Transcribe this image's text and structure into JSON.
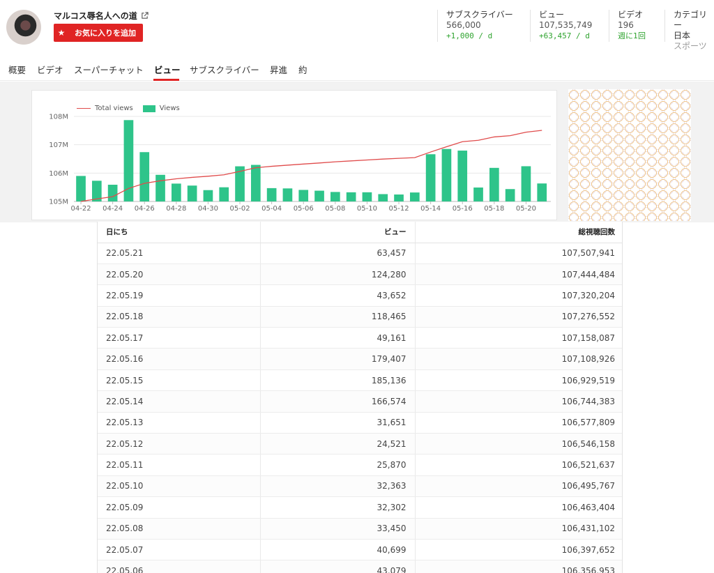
{
  "channel": {
    "title": "マルコス辱名人への道",
    "favorite_label": "お気に入りを追加"
  },
  "stats": [
    {
      "label": "サブスクライバー",
      "value": "566,000",
      "delta": "+1,000 / d"
    },
    {
      "label": "ビュー",
      "value": "107,535,749",
      "delta": "+63,457 / d"
    },
    {
      "label": "ビデオ",
      "value": "196",
      "delta": "週に1回"
    },
    {
      "label": "カテゴリー",
      "value": "日本",
      "sub": "スポーツ"
    }
  ],
  "tabs": [
    {
      "label": "概要"
    },
    {
      "label": "ビデオ"
    },
    {
      "label": "スーパーチャット"
    },
    {
      "label": "ビュー",
      "active": true
    },
    {
      "label": "サブスクライバー"
    },
    {
      "label": "昇進"
    },
    {
      "label": "約"
    }
  ],
  "chart_data": {
    "type": "bar",
    "legend": [
      "Total views",
      "Views"
    ],
    "colors": {
      "line": "#e04b4b",
      "bars": "#2ec48a"
    },
    "y_ticks": [
      "108M",
      "107M",
      "106M",
      "105M"
    ],
    "ylim": [
      105000000,
      108000000
    ],
    "x_ticks": [
      "04-22",
      "04-24",
      "04-26",
      "04-28",
      "04-30",
      "05-02",
      "05-04",
      "05-06",
      "05-08",
      "05-10",
      "05-12",
      "05-14",
      "05-16",
      "05-18",
      "05-20"
    ],
    "categories": [
      "04-22",
      "04-23",
      "04-24",
      "04-25",
      "04-26",
      "04-27",
      "04-28",
      "04-29",
      "04-30",
      "05-01",
      "05-02",
      "05-03",
      "05-04",
      "05-05",
      "05-06",
      "05-07",
      "05-08",
      "05-09",
      "05-10",
      "05-11",
      "05-12",
      "05-13",
      "05-14",
      "05-15",
      "05-16",
      "05-17",
      "05-18",
      "05-19",
      "05-20",
      "05-21"
    ],
    "series": [
      {
        "name": "Views",
        "kind": "bar",
        "values": [
          90000,
          73000,
          59000,
          287000,
          174000,
          94000,
          63000,
          56000,
          40000,
          50000,
          124000,
          129000,
          47000,
          46000,
          40699,
          38000,
          33450,
          32302,
          32363,
          25870,
          24521,
          31651,
          166574,
          185136,
          179407,
          49161,
          118465,
          43652,
          124280,
          63457
        ]
      },
      {
        "name": "Total views",
        "kind": "line",
        "values": [
          105000000,
          105090000,
          105170000,
          105460000,
          105640000,
          105730000,
          105800000,
          105850000,
          105890000,
          105940000,
          106060000,
          106190000,
          106240000,
          106280000,
          106320000,
          106356953,
          106397652,
          106431102,
          106463404,
          106495767,
          106521637,
          106546158,
          106744383,
          106929519,
          107108926,
          107158087,
          107276552,
          107320204,
          107444484,
          107507941
        ]
      }
    ]
  },
  "table": {
    "headers": [
      "日にち",
      "ビュー",
      "総視聴回数"
    ],
    "rows": [
      [
        "22.05.21",
        "63,457",
        "107,507,941"
      ],
      [
        "22.05.20",
        "124,280",
        "107,444,484"
      ],
      [
        "22.05.19",
        "43,652",
        "107,320,204"
      ],
      [
        "22.05.18",
        "118,465",
        "107,276,552"
      ],
      [
        "22.05.17",
        "49,161",
        "107,158,087"
      ],
      [
        "22.05.16",
        "179,407",
        "107,108,926"
      ],
      [
        "22.05.15",
        "185,136",
        "106,929,519"
      ],
      [
        "22.05.14",
        "166,574",
        "106,744,383"
      ],
      [
        "22.05.13",
        "31,651",
        "106,577,809"
      ],
      [
        "22.05.12",
        "24,521",
        "106,546,158"
      ],
      [
        "22.05.11",
        "25,870",
        "106,521,637"
      ],
      [
        "22.05.10",
        "32,363",
        "106,495,767"
      ],
      [
        "22.05.09",
        "32,302",
        "106,463,404"
      ],
      [
        "22.05.08",
        "33,450",
        "106,431,102"
      ],
      [
        "22.05.07",
        "40,699",
        "106,397,652"
      ],
      [
        "22.05.06",
        "43,079",
        "106,356,953"
      ]
    ]
  }
}
